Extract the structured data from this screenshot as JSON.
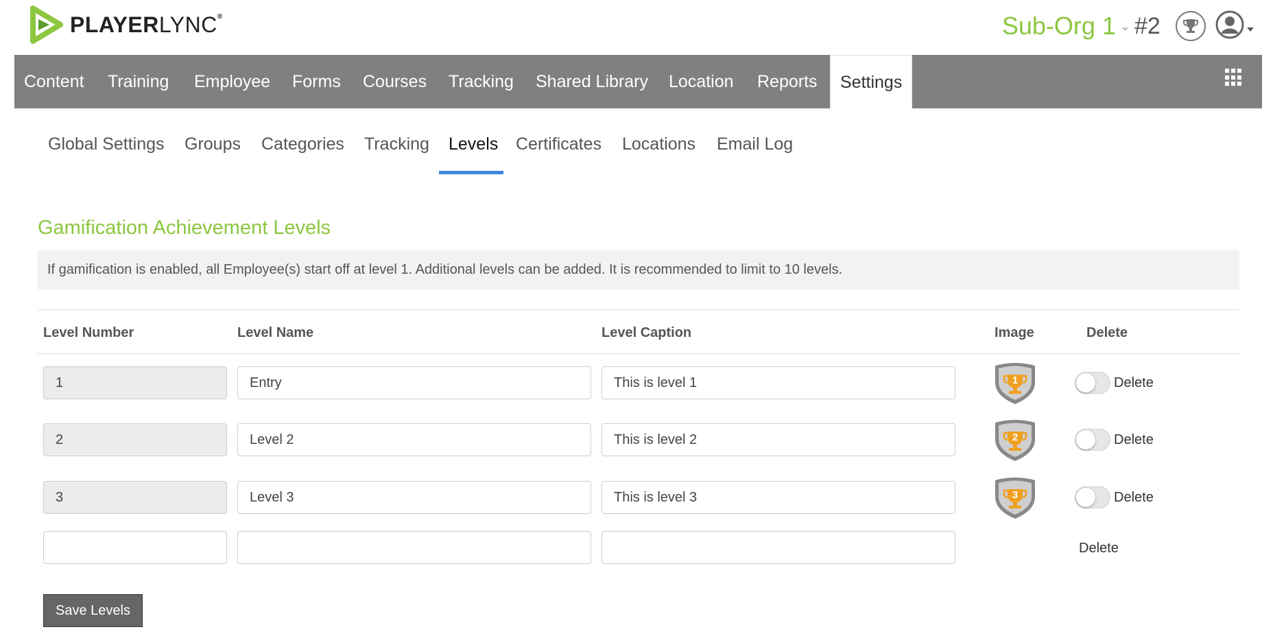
{
  "brand": {
    "logo_bold": "PLAYER",
    "logo_thin": "LYNC",
    "trademark": "®",
    "accent": "#8cc63f"
  },
  "header": {
    "org_name": "Sub-Org 1",
    "rank": "#2"
  },
  "main_nav": {
    "items": [
      {
        "label": "Content"
      },
      {
        "label": "Training"
      },
      {
        "label": "Employee"
      },
      {
        "label": "Forms"
      },
      {
        "label": "Courses"
      },
      {
        "label": "Tracking"
      },
      {
        "label": "Shared Library"
      },
      {
        "label": "Location"
      },
      {
        "label": "Reports"
      },
      {
        "label": "Settings",
        "active": true
      }
    ]
  },
  "sub_nav": {
    "items": [
      {
        "label": "Global Settings"
      },
      {
        "label": "Groups"
      },
      {
        "label": "Categories"
      },
      {
        "label": "Tracking"
      },
      {
        "label": "Levels",
        "active": true
      },
      {
        "label": "Certificates"
      },
      {
        "label": "Locations"
      },
      {
        "label": "Email Log"
      }
    ],
    "active_color": "#3f86df"
  },
  "section": {
    "title": "Gamification Achievement Levels",
    "info": "If gamification is enabled, all Employee(s) start off at level 1. Additional levels can be added. It is recommended to limit to 10 levels."
  },
  "table": {
    "headers": {
      "number": "Level Number",
      "name": "Level Name",
      "caption": "Level Caption",
      "image": "Image",
      "delete": "Delete"
    },
    "rows": [
      {
        "number": "1",
        "name": "Entry",
        "caption": "This is level 1",
        "badge": "1",
        "delete_label": "Delete",
        "delete_on": false
      },
      {
        "number": "2",
        "name": "Level 2",
        "caption": "This is level 2",
        "badge": "2",
        "delete_label": "Delete",
        "delete_on": false
      },
      {
        "number": "3",
        "name": "Level 3",
        "caption": "This is level 3",
        "badge": "3",
        "delete_label": "Delete",
        "delete_on": false
      }
    ],
    "new_row": {
      "number": "",
      "name": "",
      "caption": "",
      "delete_label": "Delete"
    }
  },
  "actions": {
    "save_label": "Save Levels"
  }
}
